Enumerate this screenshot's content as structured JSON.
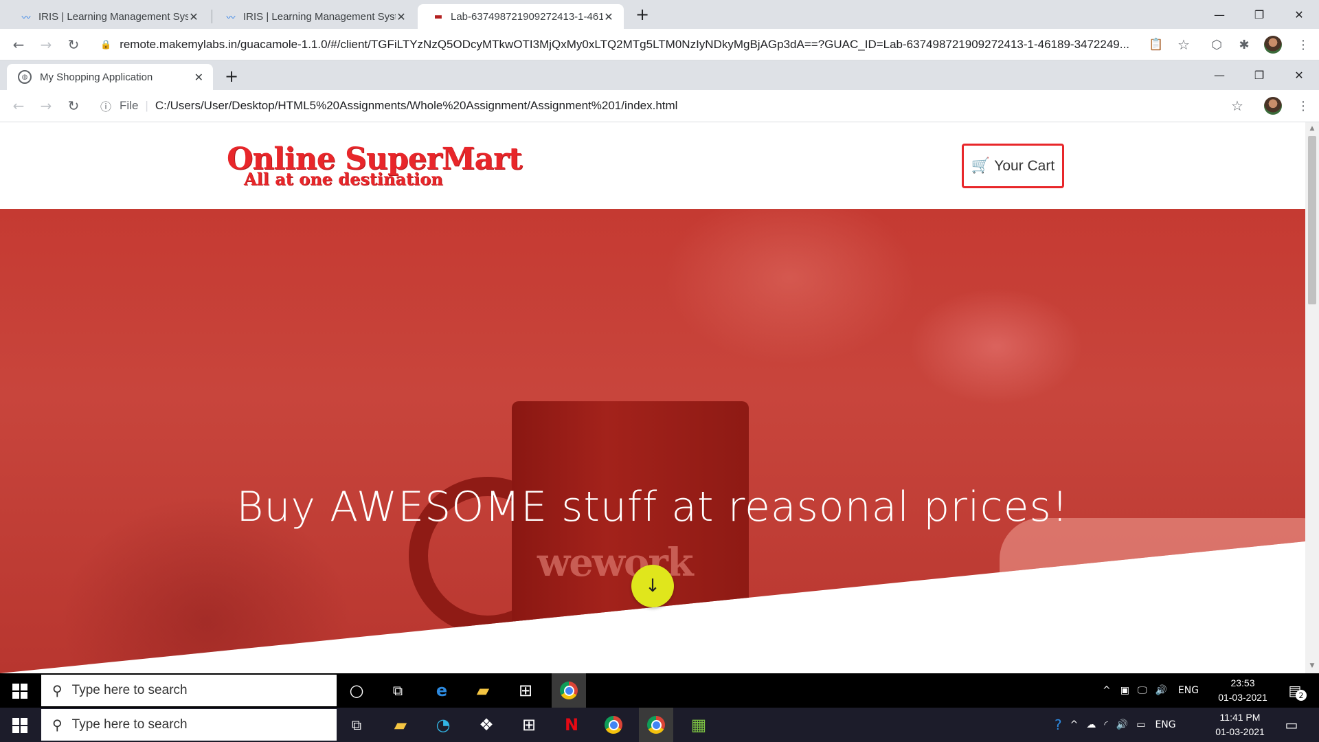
{
  "outer_browser": {
    "tabs": [
      {
        "title": "IRIS | Learning Management Syst",
        "icon": "iris-icon"
      },
      {
        "title": "IRIS | Learning Management Syst",
        "icon": "iris-icon"
      },
      {
        "title": "Lab-637498721909272413-1-461",
        "icon": "lab-icon"
      }
    ],
    "url": "remote.makemylabs.in/guacamole-1.1.0/#/client/TGFiLTYzNzQ5ODcyMTkwOTI3MjQxMy0xLTQ2MTg5LTM0NzIyNDkyMgBjAGp3dA==?GUAC_ID=Lab-637498721909272413-1-46189-3472249..."
  },
  "inner_browser": {
    "tab_title": "My Shopping Application",
    "file_label": "File",
    "url": "C:/Users/User/Desktop/HTML5%20Assignments/Whole%20Assignment/Assignment%201/index.html"
  },
  "site": {
    "logo_line1": "Online SuperMart",
    "logo_line2": "All at one destination",
    "cart_label": "Your Cart",
    "hero_title": "Buy AWESOME stuff at reasonal prices!",
    "mug_text": "wework",
    "accent": "#e8262a",
    "scroll_button_color": "#e0e61c"
  },
  "taskbar_inner": {
    "search_placeholder": "Type here to search",
    "tray_lang": "ENG",
    "time": "23:53",
    "date": "01-03-2021",
    "notification_count": "2"
  },
  "taskbar_outer": {
    "search_placeholder": "Type here to search",
    "tray_lang": "ENG",
    "time": "11:41 PM",
    "date": "01-03-2021"
  }
}
